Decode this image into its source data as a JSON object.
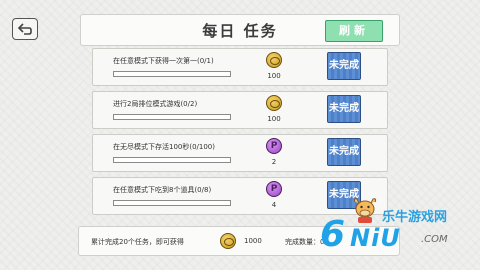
{
  "header": {
    "title": "每日 任务",
    "refresh_label": "刷新"
  },
  "tasks": [
    {
      "description": "在任意模式下获得一次第一(0/1)",
      "progress": 0,
      "reward_type": "gold",
      "reward_amount": "100",
      "status": "未完成"
    },
    {
      "description": "进行2局排位模式游戏(0/2)",
      "progress": 0,
      "reward_type": "gold",
      "reward_amount": "100",
      "status": "未完成"
    },
    {
      "description": "在无尽模式下存活100秒(0/100)",
      "progress": 0,
      "reward_type": "purple",
      "reward_symbol": "P",
      "reward_amount": "2",
      "status": "未完成"
    },
    {
      "description": "在任意模式下吃到8个道具(0/8)",
      "progress": 0,
      "reward_type": "purple",
      "reward_symbol": "P",
      "reward_amount": "4",
      "status": "未完成"
    }
  ],
  "footer": {
    "text": "累计完成20个任务，即可获得",
    "reward_amount": "1000",
    "count_text": "完成数量：0"
  },
  "watermark": {
    "site_name": "乐牛游戏网",
    "big_letter": "6",
    "letters": "NiU",
    "domain": ".COM"
  },
  "colors": {
    "accent_blue": "#5c8fd6",
    "refresh_green": "#8fe0b0",
    "gold": "#d8ab2f",
    "purple": "#b86bd9"
  }
}
